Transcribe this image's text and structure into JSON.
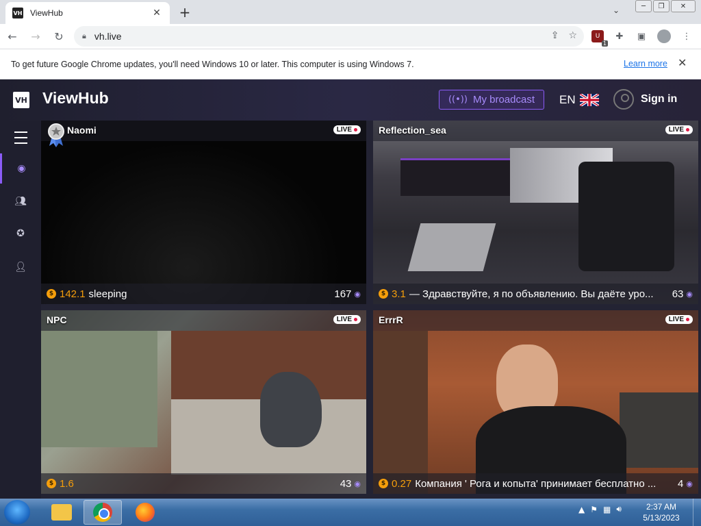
{
  "browser": {
    "tab_title": "ViewHub",
    "tab_favicon": "VH",
    "url": "vh.live",
    "ext_badge": "1"
  },
  "infobar": {
    "message": "To get future Google Chrome updates, you'll need Windows 10 or later. This computer is using Windows 7.",
    "link": "Learn more"
  },
  "site": {
    "logo": "VH",
    "brand": "ViewHub",
    "broadcast_label": "My broadcast",
    "lang": "EN",
    "signin_label": "Sign in"
  },
  "sidebar": {
    "items": [
      {
        "icon": "webcam-icon"
      },
      {
        "icon": "users-icon"
      },
      {
        "icon": "streamer-icon"
      },
      {
        "icon": "profile-icon"
      }
    ]
  },
  "cards": [
    {
      "title": "Naomi",
      "live": "LIVE",
      "coins": "142.1",
      "status": "sleeping",
      "viewers": "167"
    },
    {
      "title": "Reflection_sea",
      "live": "LIVE",
      "coins": "3.1",
      "status": "— Здравствуйте, я по объявлению. Вы даёте уро...",
      "viewers": "63"
    },
    {
      "title": "NPC",
      "live": "LIVE",
      "coins": "1.6",
      "status": "",
      "viewers": "43"
    },
    {
      "title": "ErrrR",
      "live": "LIVE",
      "coins": "0.27",
      "status": "Компания ' Рога и копыта' принимает бесплатно ...",
      "viewers": "4"
    }
  ],
  "taskbar": {
    "time": "2:37 AM",
    "date": "5/13/2023"
  },
  "colors": {
    "accent": "#8b5cf6",
    "coin": "#f59e0b",
    "header_bg": "#1f1f2e"
  }
}
